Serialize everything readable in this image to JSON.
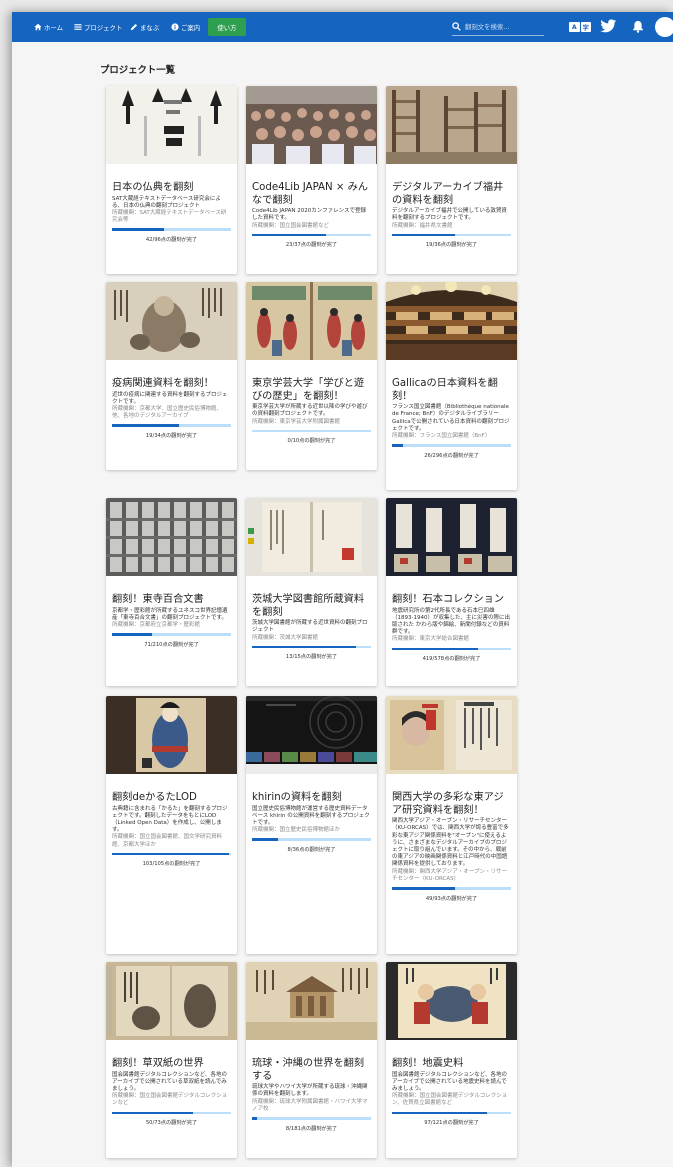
{
  "header": {
    "nav": [
      {
        "label": "ホーム",
        "icon": "home-icon"
      },
      {
        "label": "プロジェクト",
        "icon": "list-icon"
      },
      {
        "label": "まなぶ",
        "icon": "pencil-icon"
      },
      {
        "label": "ご案内",
        "icon": "info-icon"
      }
    ],
    "usage_button": "使い方",
    "search_placeholder": "翻刻文を検索...",
    "language_toggle": [
      "A",
      "字"
    ],
    "colors": {
      "topbar": "#1565c0",
      "usage_button": "#2e9e4f",
      "progress": "#1565c0",
      "progress_track": "#bbdefb"
    }
  },
  "page_title": "プロジェクト一覧",
  "projects": [
    {
      "title": "日本の仏典を翻刻",
      "description": "SAT大蔵経テキストデータベース研究会による、日本の仏典の翻刻プロジェクト",
      "org": "所蔵機関：SAT大蔵経テキストデータベース研究会等",
      "progress_text": "42/96点の翻刻が完了",
      "progress": 0.44
    },
    {
      "title": "Code4Lib JAPAN × みんなで翻刻",
      "description": "Code4Lib JAPAN 2020カンファレンスで登録した資料です。",
      "org": "所蔵機関：国立国会図書館など",
      "progress_text": "23/37点の翻刻が完了",
      "progress": 0.62
    },
    {
      "title": "デジタルアーカイブ福井の資料を翻刻",
      "description": "デジタルアーカイブ福井で公開している敦賀資料を翻刻するプロジェクトです。",
      "org": "所蔵機関：福井県文書館",
      "progress_text": "19/36点の翻刻が完了",
      "progress": 0.53
    },
    {
      "title": "疫病関連資料を翻刻！",
      "description": "近世の疫病に関連する資料を翻刻するプロジェクトです。",
      "org": "所蔵機関：京都大学、国立歴史民俗博物館、他、各地のデジタルアーカイブ",
      "progress_text": "19/34点の翻刻が完了",
      "progress": 0.56
    },
    {
      "title": "東京学芸大学「学びと遊びの歴史」を翻刻！",
      "description": "東京学芸大学が所蔵する近世以降の学びや遊びの資料翻刻プロジェクトです。",
      "org": "所蔵機関：東京学芸大学附属図書館",
      "progress_text": "0/10点の翻刻が完了",
      "progress": 0
    },
    {
      "title": "Gallicaの日本資料を翻刻！",
      "description": "フランス国立図書館（Bibliothèque nationale de France; BnF）のデジタルライブラリーGallicaで公開されている日本資料の翻刻プロジェクトです。",
      "org": "所蔵機関：フランス国立図書館（BnF）",
      "progress_text": "26/296点の翻刻が完了",
      "progress": 0.09
    },
    {
      "title": "翻刻！東寺百合文書",
      "description": "京都学・歴彩館が所蔵するユネスコ世界記憶遺産「東寺百合文書」の翻刻プロジェクトです。",
      "org": "所蔵機関：京都府立京都学・歴彩館",
      "progress_text": "71/210点の翻刻が完了",
      "progress": 0.34
    },
    {
      "title": "茨城大学図書館所蔵資料を翻刻",
      "description": "茨城大学図書館が所蔵する近世資料の翻刻プロジェクト",
      "org": "所蔵機関：茨城大学図書館",
      "progress_text": "13/15点の翻刻が完了",
      "progress": 0.87
    },
    {
      "title": "翻刻！石本コレクション",
      "description": "地震研究所の第2代所長である石本巳四雄（1893-1940）が収集した、主に災害の際に出版された かわら版や錦絵、新聞付録などの資料群です。",
      "org": "所蔵機関：東京大学総合図書館",
      "progress_text": "419/578点の翻刻が完了",
      "progress": 0.72
    },
    {
      "title": "翻刻deかるたLOD",
      "description": "古典籍に含まれる「かるた」を翻刻するプロジェクトです。翻刻したデータをもとにLOD（Linked Open Data）を作成し、公開します。",
      "org": "所蔵機関：国立国会図書館、国文学研究資料館、京都大学ほか",
      "progress_text": "103/105点の翻刻が完了",
      "progress": 0.98
    },
    {
      "title": "khirinの資料を翻刻",
      "description": "国立歴史民俗博物館が運営する歴史資料データベース khirin の公開資料を翻刻するプロジェクトです。",
      "org": "所蔵機関：国立歴史民俗博物館ほか",
      "progress_text": "8/36点の翻刻が完了",
      "progress": 0.22
    },
    {
      "title": "関西大学の多彩な東アジア研究資料を翻刻！",
      "description": "関西大学アジア・オープン・リサーチセンター（KU-ORCAS）では、関西大学が誇る豊富で多彩な東アジア関係資料を\"オープン\"に使えるように、さまざまなデジタルアーカイブのプロジェクトに取り組んでいます。その中から、戦前の東アジアの映画関係資料と江戸時代の中国語関係資料を提供しております。",
      "org": "所蔵機関：関西大学アジア・オープン・リサーチセンター（KU-ORCAS）",
      "progress_text": "49/93点の翻刻が完了",
      "progress": 0.53
    },
    {
      "title": "翻刻！草双紙の世界",
      "description": "国会図書館デジタルコレクションなど、各地のアーカイブで公開されている草双紙を読んでみましょう。",
      "org": "所蔵機関：国立国会図書館デジタルコレクションなど",
      "progress_text": "50/73点の翻刻が完了",
      "progress": 0.68
    },
    {
      "title": "琉球・沖縄の世界を翻刻する",
      "description": "琉球大学やハワイ大学が所蔵する琉球・沖縄関係の資料を翻刻します。",
      "org": "所蔵機関：琉球大学附属図書館・ハワイ大学マノア校",
      "progress_text": "8/181点の翻刻が完了",
      "progress": 0.04
    },
    {
      "title": "翻刻！地震史料",
      "description": "国会図書館デジタルコレクションなど、各地のアーカイブで公開されている地震史料を読んでみましょう。",
      "org": "所蔵機関：国立国会図書館デジタルコレクション、佐賀県立図書館など",
      "progress_text": "97/121点の翻刻が完了",
      "progress": 0.8
    }
  ]
}
